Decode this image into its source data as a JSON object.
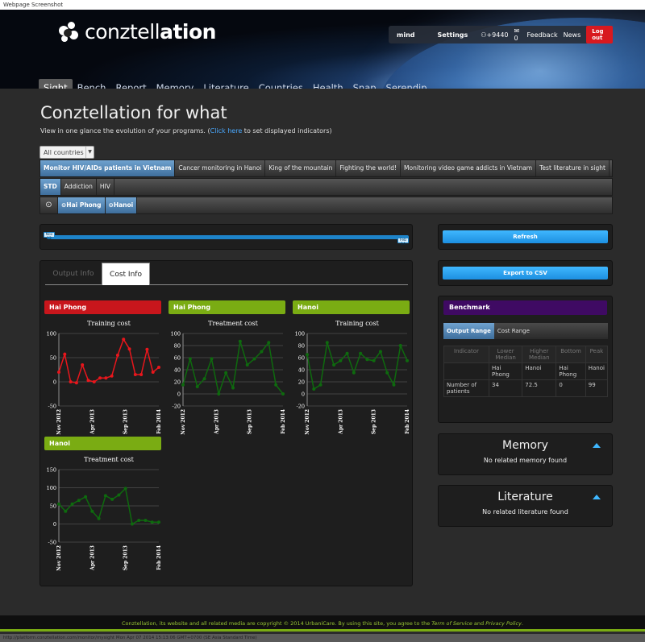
{
  "browser": {
    "caption": "Webpage Screenshot",
    "status_url": "http://platform.conztellation.com/monitor/mysight Mon Apr 07 2014 15:13:06 GMT+0700 (SE Asia Standard Time)"
  },
  "header": {
    "logo_text_light": "conztell",
    "logo_text_bold": "ation",
    "user_menu": {
      "mind": "mind",
      "settings": "Settings",
      "points": "+9440",
      "messages": "0",
      "feedback": "Feedback",
      "news": "News",
      "logout": "Log out"
    }
  },
  "nav": {
    "items": [
      "Sight",
      "Bench",
      "Report",
      "Memory",
      "Literature",
      "Countries",
      "Health",
      "Snap",
      "Serendip"
    ],
    "active": "Sight"
  },
  "page": {
    "title": "Conztellation for what",
    "subtitle_pre": "View in one glance the evolution of your programs. (",
    "subtitle_link": "Click here",
    "subtitle_post": " to set displayed indicators)"
  },
  "filters": {
    "country_select": "All countries",
    "programs": [
      "Monitor HIV/AIDs patients in Vietnam",
      "Cancer monitoring in Hanoi",
      "King of the mountain",
      "Fighting the world!",
      "Monitoring video game addicts in Vietnam",
      "Test literature in sight"
    ],
    "topics": [
      "STD",
      "Addiction",
      "HIV"
    ],
    "locations": [
      "Hai Phong",
      "Hanoi"
    ]
  },
  "timeline": {
    "start_label": "Nov 12",
    "end_label": "Feb 14",
    "start_fraction": 0.0,
    "end_fraction": 1.0
  },
  "actions": {
    "refresh": "Refresh",
    "export": "Export to CSV"
  },
  "tabs": {
    "output_info": "Output Info",
    "cost_info": "Cost Info"
  },
  "colors": {
    "red": "#c8161c",
    "green": "#7aac13",
    "dark_green": "#0e6a0e",
    "line_red": "#e8161c",
    "blue": "#1e84c9"
  },
  "charts": [
    {
      "header": "Hai Phong",
      "header_color": "red",
      "chart_data": {
        "type": "line",
        "title": "Training cost",
        "ylim": [
          -20,
          100
        ],
        "yticks": [
          100,
          50,
          0,
          -50
        ],
        "xticks": [
          "Nov 2012",
          "Apr 2013",
          "Sep 2013",
          "Feb 2014"
        ],
        "series": [
          {
            "color": "#e8161c",
            "values": [
              20,
              57,
              0,
              -2,
              35,
              3,
              0,
              8,
              8,
              12,
              55,
              88,
              68,
              15,
              15,
              67,
              20,
              30
            ]
          }
        ]
      }
    },
    {
      "header": "Hai Phong",
      "header_color": "green",
      "chart_data": {
        "type": "line",
        "title": "Treatment cost",
        "ylim": [
          -20,
          100
        ],
        "yticks": [
          100,
          80,
          60,
          40,
          20,
          0,
          -20
        ],
        "xticks": [
          "Nov 2012",
          "Apr 2013",
          "Sep 2013",
          "Feb 2014"
        ],
        "series": [
          {
            "color": "#0e6a0e",
            "values": [
              15,
              58,
              12,
              25,
              58,
              0,
              35,
              10,
              87,
              48,
              58,
              70,
              85,
              15,
              0
            ]
          }
        ]
      }
    },
    {
      "header": "Hanoi",
      "header_color": "green",
      "chart_data": {
        "type": "line",
        "title": "Training cost",
        "ylim": [
          -20,
          100
        ],
        "yticks": [
          100,
          80,
          60,
          40,
          20,
          0,
          -20
        ],
        "xticks": [
          "Nov 2012",
          "Apr 2013",
          "Sep 2013",
          "Feb 2014"
        ],
        "series": [
          {
            "color": "#0e6a0e",
            "values": [
              65,
              8,
              15,
              85,
              48,
              55,
              67,
              35,
              67,
              57,
              55,
              70,
              35,
              15,
              80,
              55
            ]
          }
        ]
      }
    },
    {
      "header": "Hanoi",
      "header_color": "green",
      "chart_data": {
        "type": "line",
        "title": "Treatment cost",
        "ylim": [
          -50,
          150
        ],
        "yticks": [
          150,
          100,
          50,
          0,
          -50
        ],
        "xticks": [
          "Nov 2012",
          "Apr 2013",
          "Sep 2013",
          "Feb 2014"
        ],
        "series": [
          {
            "color": "#0e6a0e",
            "values": [
              55,
              35,
              55,
              65,
              75,
              35,
              15,
              78,
              68,
              80,
              98,
              0,
              10,
              10,
              5,
              5
            ]
          }
        ]
      }
    }
  ],
  "benchmark": {
    "title": "Benchmark",
    "tabs": [
      "Output Range",
      "Cost Range"
    ],
    "headers": [
      "Indicator",
      "Lower Median",
      "Higher Median",
      "Bottom",
      "Peak"
    ],
    "location_row": [
      "",
      "Hai Phong",
      "Hanoi",
      "Hai Phong",
      "Hanoi"
    ],
    "rows": [
      [
        "Number of patients",
        "34",
        "72.5",
        "0",
        "99"
      ]
    ]
  },
  "memory": {
    "title": "Memory",
    "text": "No related memory found"
  },
  "literature": {
    "title": "Literature",
    "text": "No related literature found"
  },
  "footer": {
    "pre": "Conztellation, its website and all related media are copyright © 2014 UrbaniCare. By using this site, you agree to the ",
    "tos": "Term of Service",
    "mid": " and ",
    "privacy": "Privacy Policy",
    "post": "."
  }
}
